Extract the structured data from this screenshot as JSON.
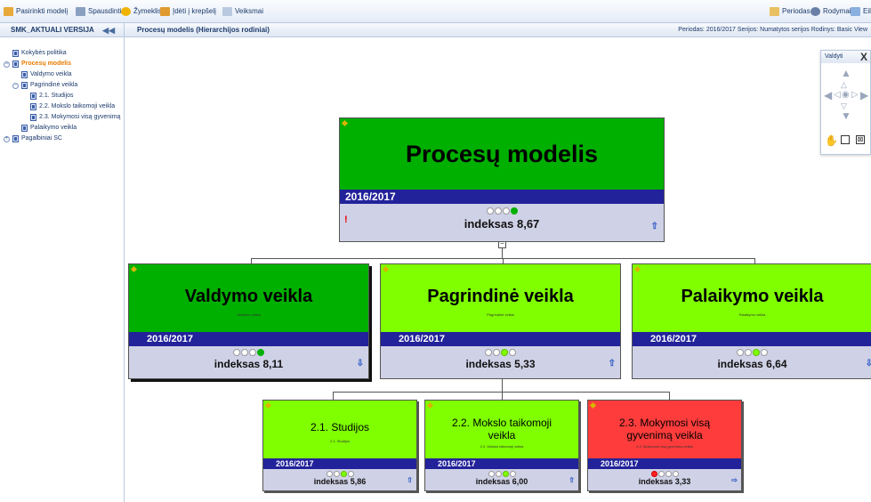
{
  "toolbar": {
    "items": [
      {
        "label": "Pasirinkti modelį",
        "icon": "folder-icon"
      },
      {
        "label": "Spausdinti",
        "icon": "printer-icon"
      },
      {
        "label": "Žymeklis",
        "icon": "star-icon"
      },
      {
        "label": "Įdėti į krepšelį",
        "icon": "basket-icon"
      },
      {
        "label": "Veiksmai",
        "icon": "actions-icon"
      }
    ],
    "right_items": [
      {
        "label": "Periodas",
        "icon": "calendar-icon"
      },
      {
        "label": "Rodymai",
        "icon": "view-icon"
      },
      {
        "label": "Eile",
        "icon": "chart-icon"
      }
    ]
  },
  "sidebar": {
    "title": "SMK_AKTUALI VERSIJA",
    "collapse_glyph": "◀◀",
    "items": [
      {
        "label": "Kokybės politika",
        "expander": ""
      },
      {
        "label": "Procesų modelis",
        "expander": "−"
      },
      {
        "label": "Valdymo veikla",
        "expander": ""
      },
      {
        "label": "Pagrindinė veikla",
        "expander": "−"
      },
      {
        "label": "2.1. Studijos",
        "expander": ""
      },
      {
        "label": "2.2. Mokslo taikomoji veikla",
        "expander": ""
      },
      {
        "label": "2.3. Mokymosi visą gyvenimą",
        "expander": ""
      },
      {
        "label": "Palaikymo veikla",
        "expander": ""
      },
      {
        "label": "Pagalbiniai SC",
        "expander": "+"
      }
    ]
  },
  "main_header": {
    "title": "Procesų modelis (Hierarchijos rodiniai)",
    "info": "Periodas: 2016/2017   Serijos: Numatytos serijos   Rodinys: Basic View"
  },
  "control_panel": {
    "title": "Valdyti",
    "close": "X",
    "hand_icon": "hand-icon",
    "fit_icon": "fit-icon",
    "zoom_icon": "zoom-icon"
  },
  "colors": {
    "dark_green": "#00b000",
    "light_green": "#7fff00",
    "red": "#ff3c3c",
    "navy": "#22229a",
    "foot": "#cfd1e6"
  },
  "nodes": {
    "root": {
      "title": "Procesų modelis",
      "year": "2016/2017",
      "index": "indeksas 8,67",
      "dots": [
        "white",
        "white",
        "white",
        "green"
      ],
      "arrow": "⇧",
      "excl": "!"
    },
    "valdymo": {
      "title": "Valdymo veikla",
      "sub": "Valdymo veikla",
      "year": "2016/2017",
      "index": "indeksas 8,11",
      "dots": [
        "white",
        "white",
        "white",
        "green"
      ],
      "arrow": "⇩"
    },
    "pagrindine": {
      "title": "Pagrindinė veikla",
      "sub": "Pagrindinė veikla",
      "year": "2016/2017",
      "index": "indeksas 5,33",
      "dots": [
        "white",
        "white",
        "lime",
        "white"
      ],
      "arrow": "⇧"
    },
    "palaikymo": {
      "title": "Palaikymo veikla",
      "sub": "Palaikymo veikla",
      "year": "2016/2017",
      "index": "indeksas 6,64",
      "dots": [
        "white",
        "white",
        "lime",
        "white"
      ],
      "arrow": "⇩"
    },
    "studijos": {
      "title": "2.1. Studijos",
      "sub": "2.1. Studijos",
      "year": "2016/2017",
      "index": "indeksas 5,86",
      "dots": [
        "white",
        "white",
        "lime",
        "white"
      ],
      "arrow": "⇧"
    },
    "mokslo": {
      "title": "2.2. Mokslo taikomoji veikla",
      "sub": "2.2. Mokslo taikomoji veikla",
      "year": "2016/2017",
      "index": "indeksas 6,00",
      "dots": [
        "white",
        "white",
        "lime",
        "white"
      ],
      "arrow": "⇧"
    },
    "mokymosi": {
      "title": "2.3. Mokymosi visą gyvenimą veikla",
      "sub": "2.3. Mokymosi visą gyvenimą veikla",
      "year": "2016/2017",
      "index": "indeksas 3,33",
      "dots": [
        "red",
        "white",
        "white",
        "white"
      ],
      "arrow": "⇨"
    }
  }
}
